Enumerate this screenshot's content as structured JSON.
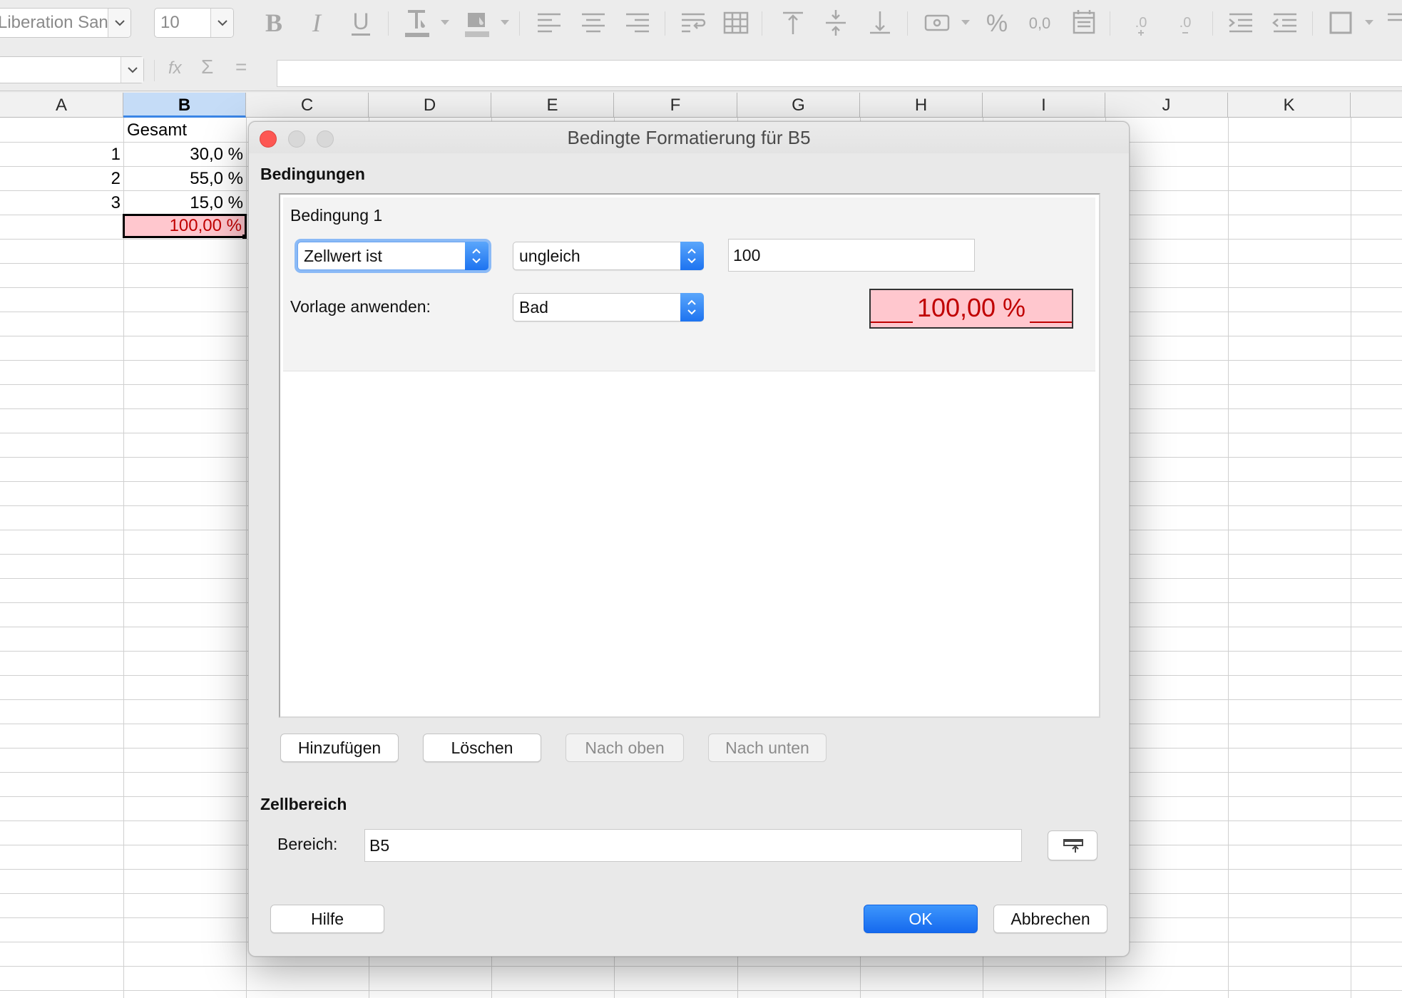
{
  "toolbar": {
    "font_name": "Liberation Sans",
    "font_size": "10",
    "icons": [
      "bold-icon",
      "italic-icon",
      "underline-icon",
      "font-color-icon",
      "highlight-color-icon",
      "align-left-icon",
      "align-center-icon",
      "align-right-icon",
      "wrap-text-icon",
      "merge-cells-icon",
      "align-top-icon",
      "center-vertically-icon",
      "align-bottom-icon",
      "currency-format-icon",
      "percent-format-icon",
      "number-format-icon",
      "date-format-icon",
      "add-decimal-icon",
      "delete-decimal-icon",
      "increase-indent-icon",
      "decrease-indent-icon",
      "borders-icon"
    ]
  },
  "formula_bar": {
    "name_box": "",
    "function_wizard": "fx",
    "sum_symbol": "Σ",
    "equals_symbol": "=",
    "formula": ""
  },
  "sheet": {
    "columns": [
      "A",
      "B",
      "C",
      "D",
      "E",
      "F",
      "G",
      "H",
      "I",
      "J",
      "K"
    ],
    "selected_column": "B",
    "cells": {
      "b1": "Gesamt",
      "a2": "1",
      "b2": "30,0 %",
      "a3": "2",
      "b3": "55,0 %",
      "a4": "3",
      "b4": "15,0 %",
      "b5": "100,00 %"
    }
  },
  "dialog": {
    "title": "Bedingte Formatierung für B5",
    "conditions_heading": "Bedingungen",
    "condition": {
      "label": "Bedingung 1",
      "type": "Zellwert ist",
      "operator": "ungleich",
      "value": "100",
      "apply_style_label": "Vorlage anwenden:",
      "style": "Bad",
      "preview": "100,00 %"
    },
    "buttons": {
      "add": "Hinzufügen",
      "delete": "Löschen",
      "up": "Nach oben",
      "down": "Nach unten",
      "help": "Hilfe",
      "ok": "OK",
      "cancel": "Abbrechen"
    },
    "range_heading": "Zellbereich",
    "range_label": "Bereich:",
    "range_value": "B5"
  },
  "colors": {
    "bad_fill": "#ffc7ce",
    "bad_text": "#c00000",
    "accent": "#1569ee"
  }
}
